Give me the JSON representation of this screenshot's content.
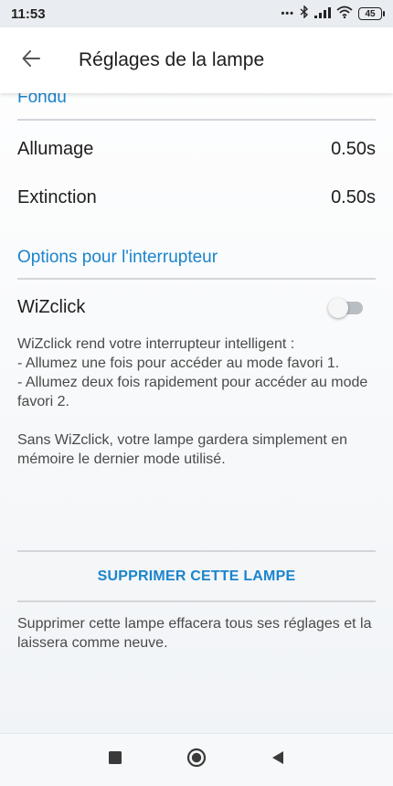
{
  "status_bar": {
    "time": "11:53",
    "dots": "•••",
    "battery": "45"
  },
  "app_bar": {
    "title": "Réglages de la lampe"
  },
  "fade_section": {
    "heading": "Fondu",
    "rows": [
      {
        "label": "Allumage",
        "value": "0.50s"
      },
      {
        "label": "Extinction",
        "value": "0.50s"
      }
    ]
  },
  "switch_section": {
    "heading": "Options pour l'interrupteur",
    "wizclick_label": "WiZclick",
    "wizclick_enabled": false,
    "description_lines": [
      "WiZclick rend votre interrupteur intelligent :",
      "- Allumez une fois pour accéder au mode favori 1.",
      "- Allumez deux fois rapidement pour accéder au mode favori 2.",
      "",
      "Sans WiZclick, votre lampe gardera simplement en mémoire le dernier mode utilisé."
    ]
  },
  "delete_section": {
    "button_label": "SUPPRIMER CETTE LAMPE",
    "description": "Supprimer cette lampe effacera tous ses réglages et la laissera comme neuve."
  },
  "colors": {
    "accent": "#1b84cc",
    "divider": "#d2d6da"
  }
}
